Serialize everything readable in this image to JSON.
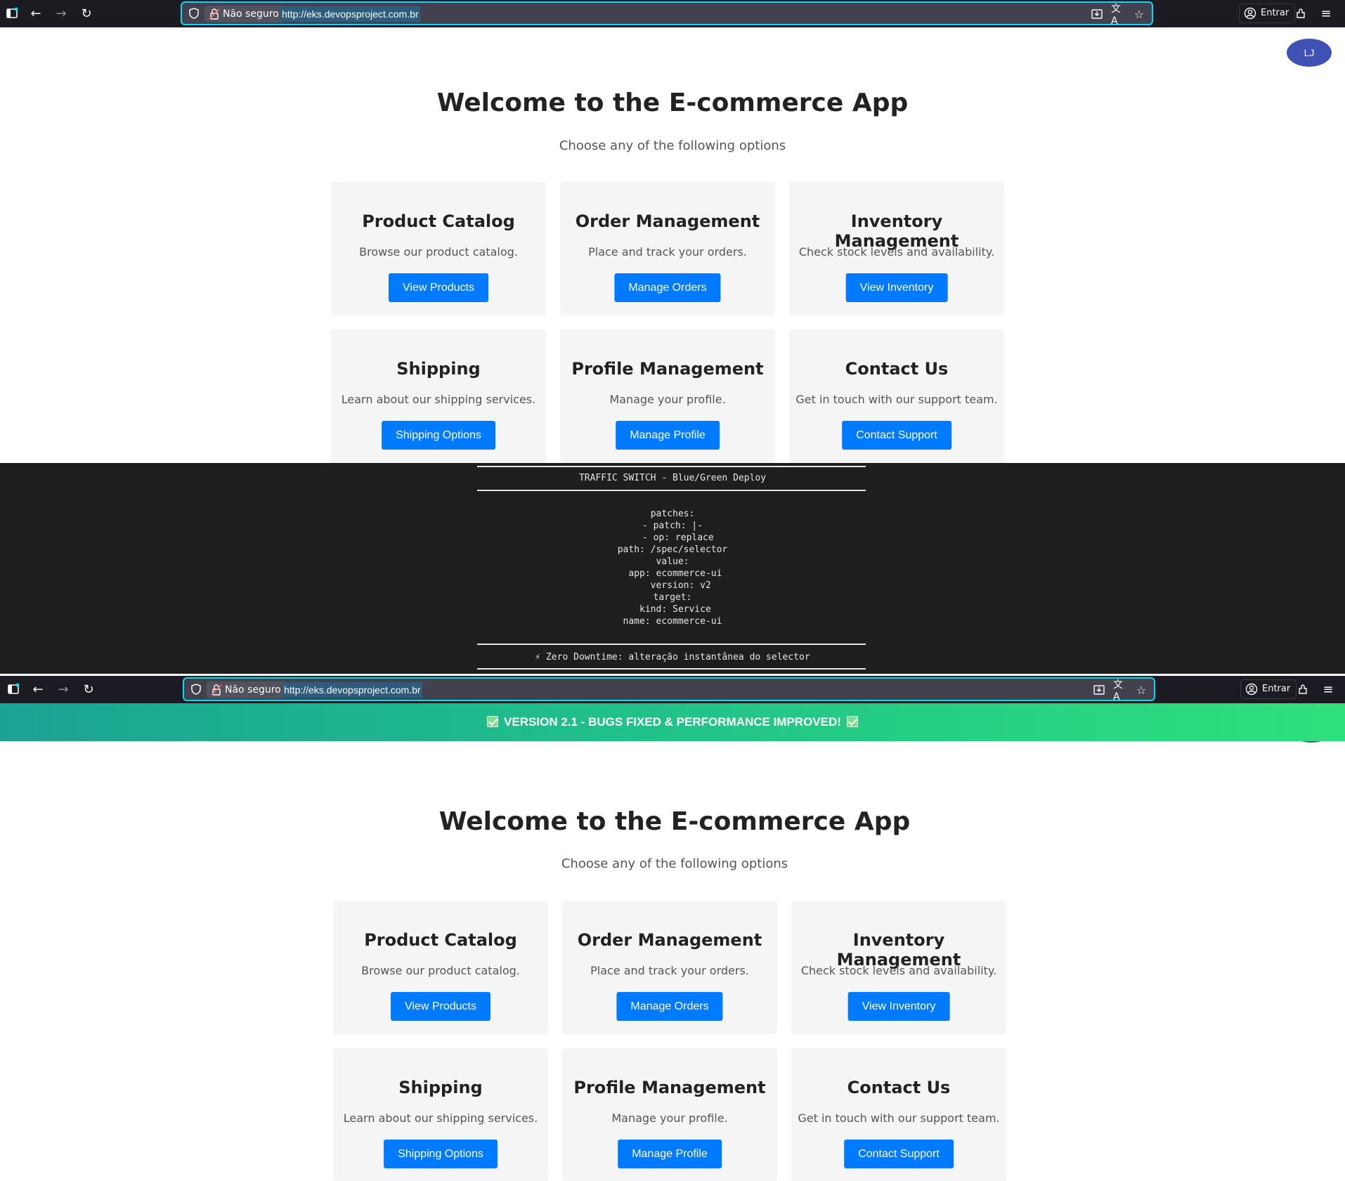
{
  "browser": {
    "security_label": "Não seguro",
    "url": "http://eks.devopsproject.com.br",
    "account_label": "Entrar"
  },
  "user": {
    "initials": "LJ"
  },
  "page": {
    "title": "Welcome to the E-commerce App",
    "subtitle": "Choose any of the following options",
    "cards": [
      {
        "title": "Product Catalog",
        "description": "Browse our product catalog.",
        "button": "View Products"
      },
      {
        "title": "Order Management",
        "description": "Place and track your orders.",
        "button": "Manage Orders"
      },
      {
        "title": "Inventory Management",
        "description": "Check stock levels and availability.",
        "button": "View Inventory"
      },
      {
        "title": "Shipping",
        "description": "Learn about our shipping services.",
        "button": "Shipping Options"
      },
      {
        "title": "Profile Management",
        "description": "Manage your profile.",
        "button": "Manage Profile"
      },
      {
        "title": "Contact Us",
        "description": "Get in touch with our support team.",
        "button": "Contact Support"
      }
    ]
  },
  "terminal": {
    "header": "TRAFFIC SWITCH - Blue/Green Deploy",
    "code": "patches:\n- patch: |-\n  - op: replace\npath: /spec/selector\nvalue:\n app: ecommerce-ui\n   version: v2\ntarget:\n kind: Service\nname: ecommerce-ui",
    "footer": "⚡ Zero Downtime: alteração instantânea do selector"
  },
  "banner": {
    "text": "VERSION 2.1 - BUGS FIXED & PERFORMANCE IMPROVED!"
  },
  "colors": {
    "button_blue": "#007bff",
    "avatar": "#3f51b5",
    "chrome_bg": "#1c1b22",
    "terminal_bg": "#1e1e1e",
    "banner_start": "#1aa394",
    "banner_end": "#2ee07c"
  }
}
